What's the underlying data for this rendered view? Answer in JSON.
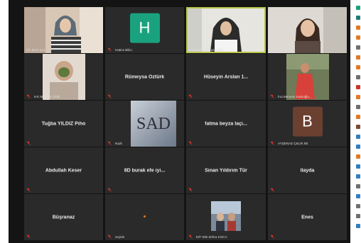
{
  "colors": {
    "tile_bg": "#2a2a2a",
    "grid_bg": "#141414",
    "active_border": "#b7c54a",
    "name_text": "#e9e9e9",
    "mic_muted": "#e33a2c",
    "avatar_H": "#1aa27e",
    "avatar_B": "#6b4030"
  },
  "tiles": [
    {
      "label": "Zin Esra ŞAL",
      "type": "photo",
      "muted": false
    },
    {
      "label": "Hatice Bilici",
      "type": "avatar",
      "initial": "H",
      "muted": true
    },
    {
      "label": "Eczacı Esra Özşah Ünlü",
      "type": "photo",
      "muted": false,
      "active": true
    },
    {
      "label": "Buket BURDU",
      "type": "photo",
      "muted": false
    },
    {
      "label": "8-E MERVE Özdil",
      "type": "photo",
      "muted": true
    },
    {
      "name": "Rümeysa Öztürk",
      "type": "name",
      "muted": true
    },
    {
      "name": "Hüseyin Arslan 1...",
      "type": "name",
      "muted": true
    },
    {
      "label": "İrıa Meryem Kadıoğlu...",
      "type": "photo",
      "muted": true
    },
    {
      "name": "Tuğba YILDIZ Piho",
      "type": "name",
      "muted": true
    },
    {
      "label": "Nazlı",
      "type": "photo",
      "photo_text": "SAD",
      "muted": true
    },
    {
      "name": "fatma beyza laçi...",
      "type": "name",
      "muted": true
    },
    {
      "label": "AYŞENAZ ÇELİK 8E",
      "type": "avatar",
      "initial": "B",
      "muted": true
    },
    {
      "name": "Abdullah Keser",
      "type": "name",
      "muted": true
    },
    {
      "name": "8D burak efe iyi...",
      "type": "name",
      "muted": true
    },
    {
      "name": "Sinan Yıldırım Tür",
      "type": "name",
      "muted": true
    },
    {
      "name": "İlayda",
      "type": "name",
      "muted": true
    },
    {
      "name": "Büşranaz",
      "type": "name",
      "muted": true
    },
    {
      "label": "zeyide",
      "type": "dot",
      "muted": true
    },
    {
      "label": "E/F 835 Zehra KOCA",
      "type": "photo",
      "muted": true
    },
    {
      "name": "Enes",
      "type": "name",
      "muted": true
    }
  ],
  "sidebar_icons": [
    "green",
    "teal",
    "orange",
    "orange",
    "gray",
    "orange",
    "orange",
    "gray",
    "red",
    "orange",
    "gray",
    "orange",
    "brown",
    "blue",
    "blue",
    "orange",
    "blue",
    "blue",
    "gray",
    "blue",
    "gray",
    "gray",
    "blue"
  ]
}
